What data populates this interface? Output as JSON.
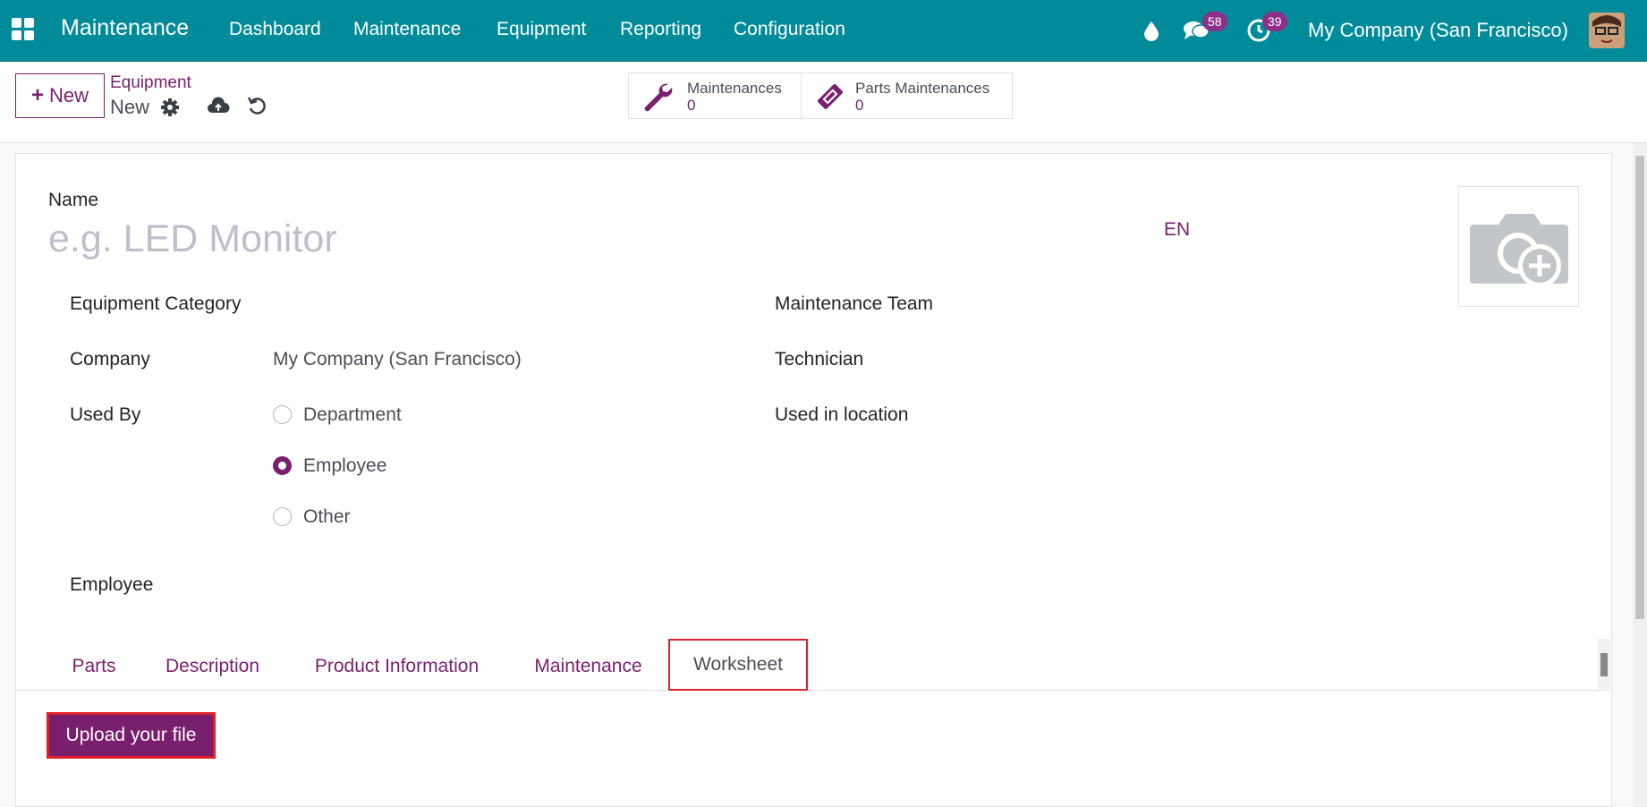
{
  "nav": {
    "app_name": "Maintenance",
    "menus": [
      "Dashboard",
      "Maintenance",
      "Equipment",
      "Reporting",
      "Configuration"
    ],
    "messages_count": "58",
    "activities_count": "39",
    "company": "My Company (San Francisco)",
    "icons": [
      "apps-icon",
      "drop-icon",
      "chat-icon",
      "clock-icon",
      "avatar"
    ]
  },
  "control_panel": {
    "new_label": "New",
    "breadcrumb_parent": "Equipment",
    "breadcrumb_current": "New",
    "smart_buttons": [
      {
        "label": "Maintenances",
        "value": "0",
        "icon": "wrench-icon"
      },
      {
        "label": "Parts Maintenances",
        "value": "0",
        "icon": "ticket-icon"
      }
    ]
  },
  "form": {
    "name_label": "Name",
    "name_placeholder": "e.g. LED Monitor",
    "lang": "EN",
    "fields_left": {
      "equipment_category": "Equipment Category",
      "company": "Company",
      "company_value": "My Company (San Francisco)",
      "used_by": "Used By",
      "employee": "Employee"
    },
    "used_by_options": [
      {
        "label": "Department",
        "selected": false
      },
      {
        "label": "Employee",
        "selected": true
      },
      {
        "label": "Other",
        "selected": false
      }
    ],
    "fields_right": {
      "maintenance_team": "Maintenance Team",
      "technician": "Technician",
      "used_in_location": "Used in location"
    },
    "tabs": [
      "Parts",
      "Description",
      "Product Information",
      "Maintenance",
      "Worksheet"
    ],
    "active_tab": "Worksheet",
    "upload_label": "Upload your file"
  },
  "colors": {
    "navbar": "#008b9a",
    "primary": "#7a1f6e",
    "highlight": "#d9232d"
  }
}
